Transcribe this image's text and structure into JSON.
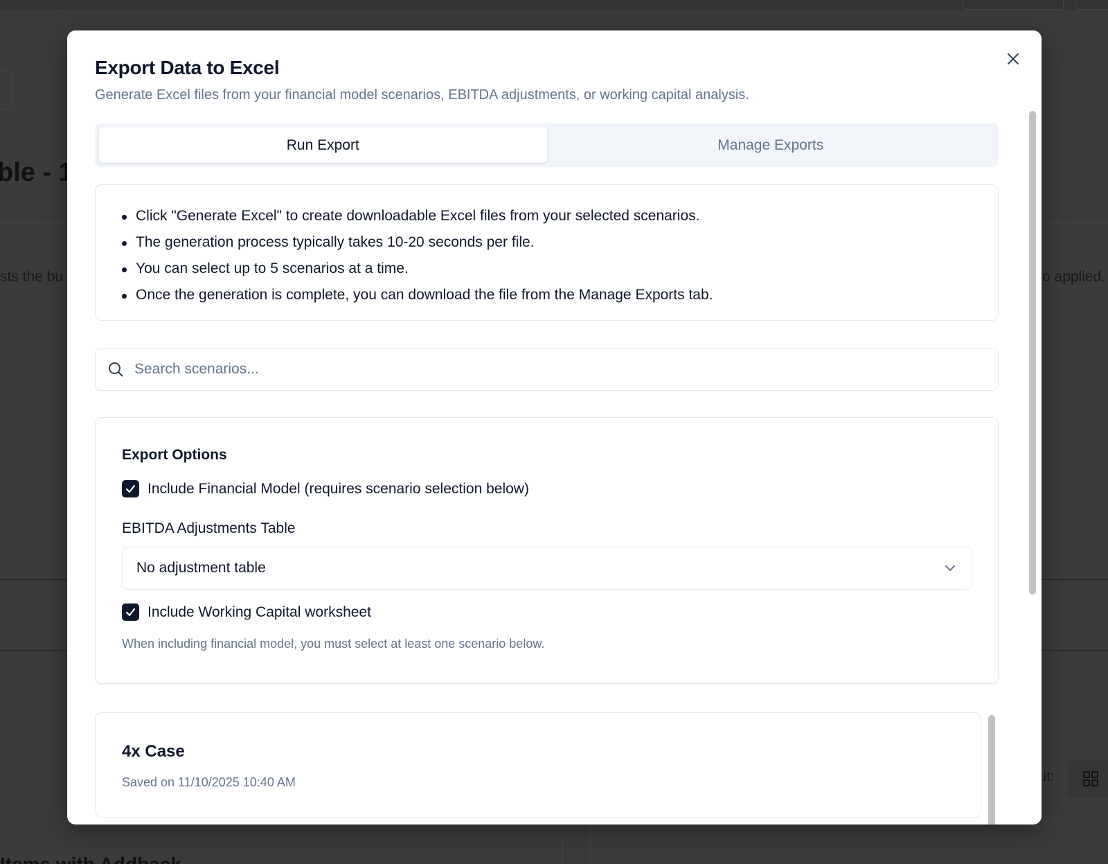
{
  "background": {
    "page_title_fragment": "ble - 1",
    "left_text_fragment": "sts the bu",
    "right_text_fragment": "o applied.",
    "layout_label_fragment": "ut:",
    "bottom_title_fragment": "Items with Addback"
  },
  "modal": {
    "title": "Export Data to Excel",
    "description": "Generate Excel files from your financial model scenarios, EBITDA adjustments, or working capital analysis.",
    "close_label": "Close"
  },
  "tabs": [
    {
      "label": "Run Export",
      "active": true
    },
    {
      "label": "Manage Exports",
      "active": false
    }
  ],
  "info": {
    "items": [
      {
        "pre": "Click ",
        "bold": "\"Generate Excel\"",
        "post": " to create downloadable Excel files from your selected scenarios."
      },
      {
        "pre": "The generation process typically takes ",
        "bold": "10-20 seconds per file",
        "post": "."
      },
      {
        "pre": "You can select up to ",
        "bold": "5 scenarios",
        "post": " at a time."
      },
      {
        "pre": "Once the generation is complete, you can download the file from the ",
        "bold": "Manage Exports",
        "post": " tab."
      }
    ]
  },
  "search": {
    "placeholder": "Search scenarios...",
    "value": ""
  },
  "export_options": {
    "heading": "Export Options",
    "include_financial_model": {
      "label": "Include Financial Model (requires scenario selection below)",
      "checked": true
    },
    "ebitda_select": {
      "label": "EBITDA Adjustments Table",
      "value": "No adjustment table"
    },
    "include_working_capital": {
      "label": "Include Working Capital worksheet",
      "checked": true
    },
    "helper_text": "When including financial model, you must select at least one scenario below."
  },
  "scenarios": [
    {
      "name": "4x Case",
      "saved": "Saved on 11/10/2025 10:40 AM"
    }
  ],
  "colors": {
    "primary": "#0f172a",
    "muted_text": "#64748b",
    "border": "#e2e8f0",
    "tab_bg": "#f1f5f9",
    "overlay": "#3b3b3b"
  },
  "icons": {
    "close": "close-icon",
    "search": "search-icon",
    "checkbox": "check-icon",
    "select": "chevron-down-icon"
  }
}
